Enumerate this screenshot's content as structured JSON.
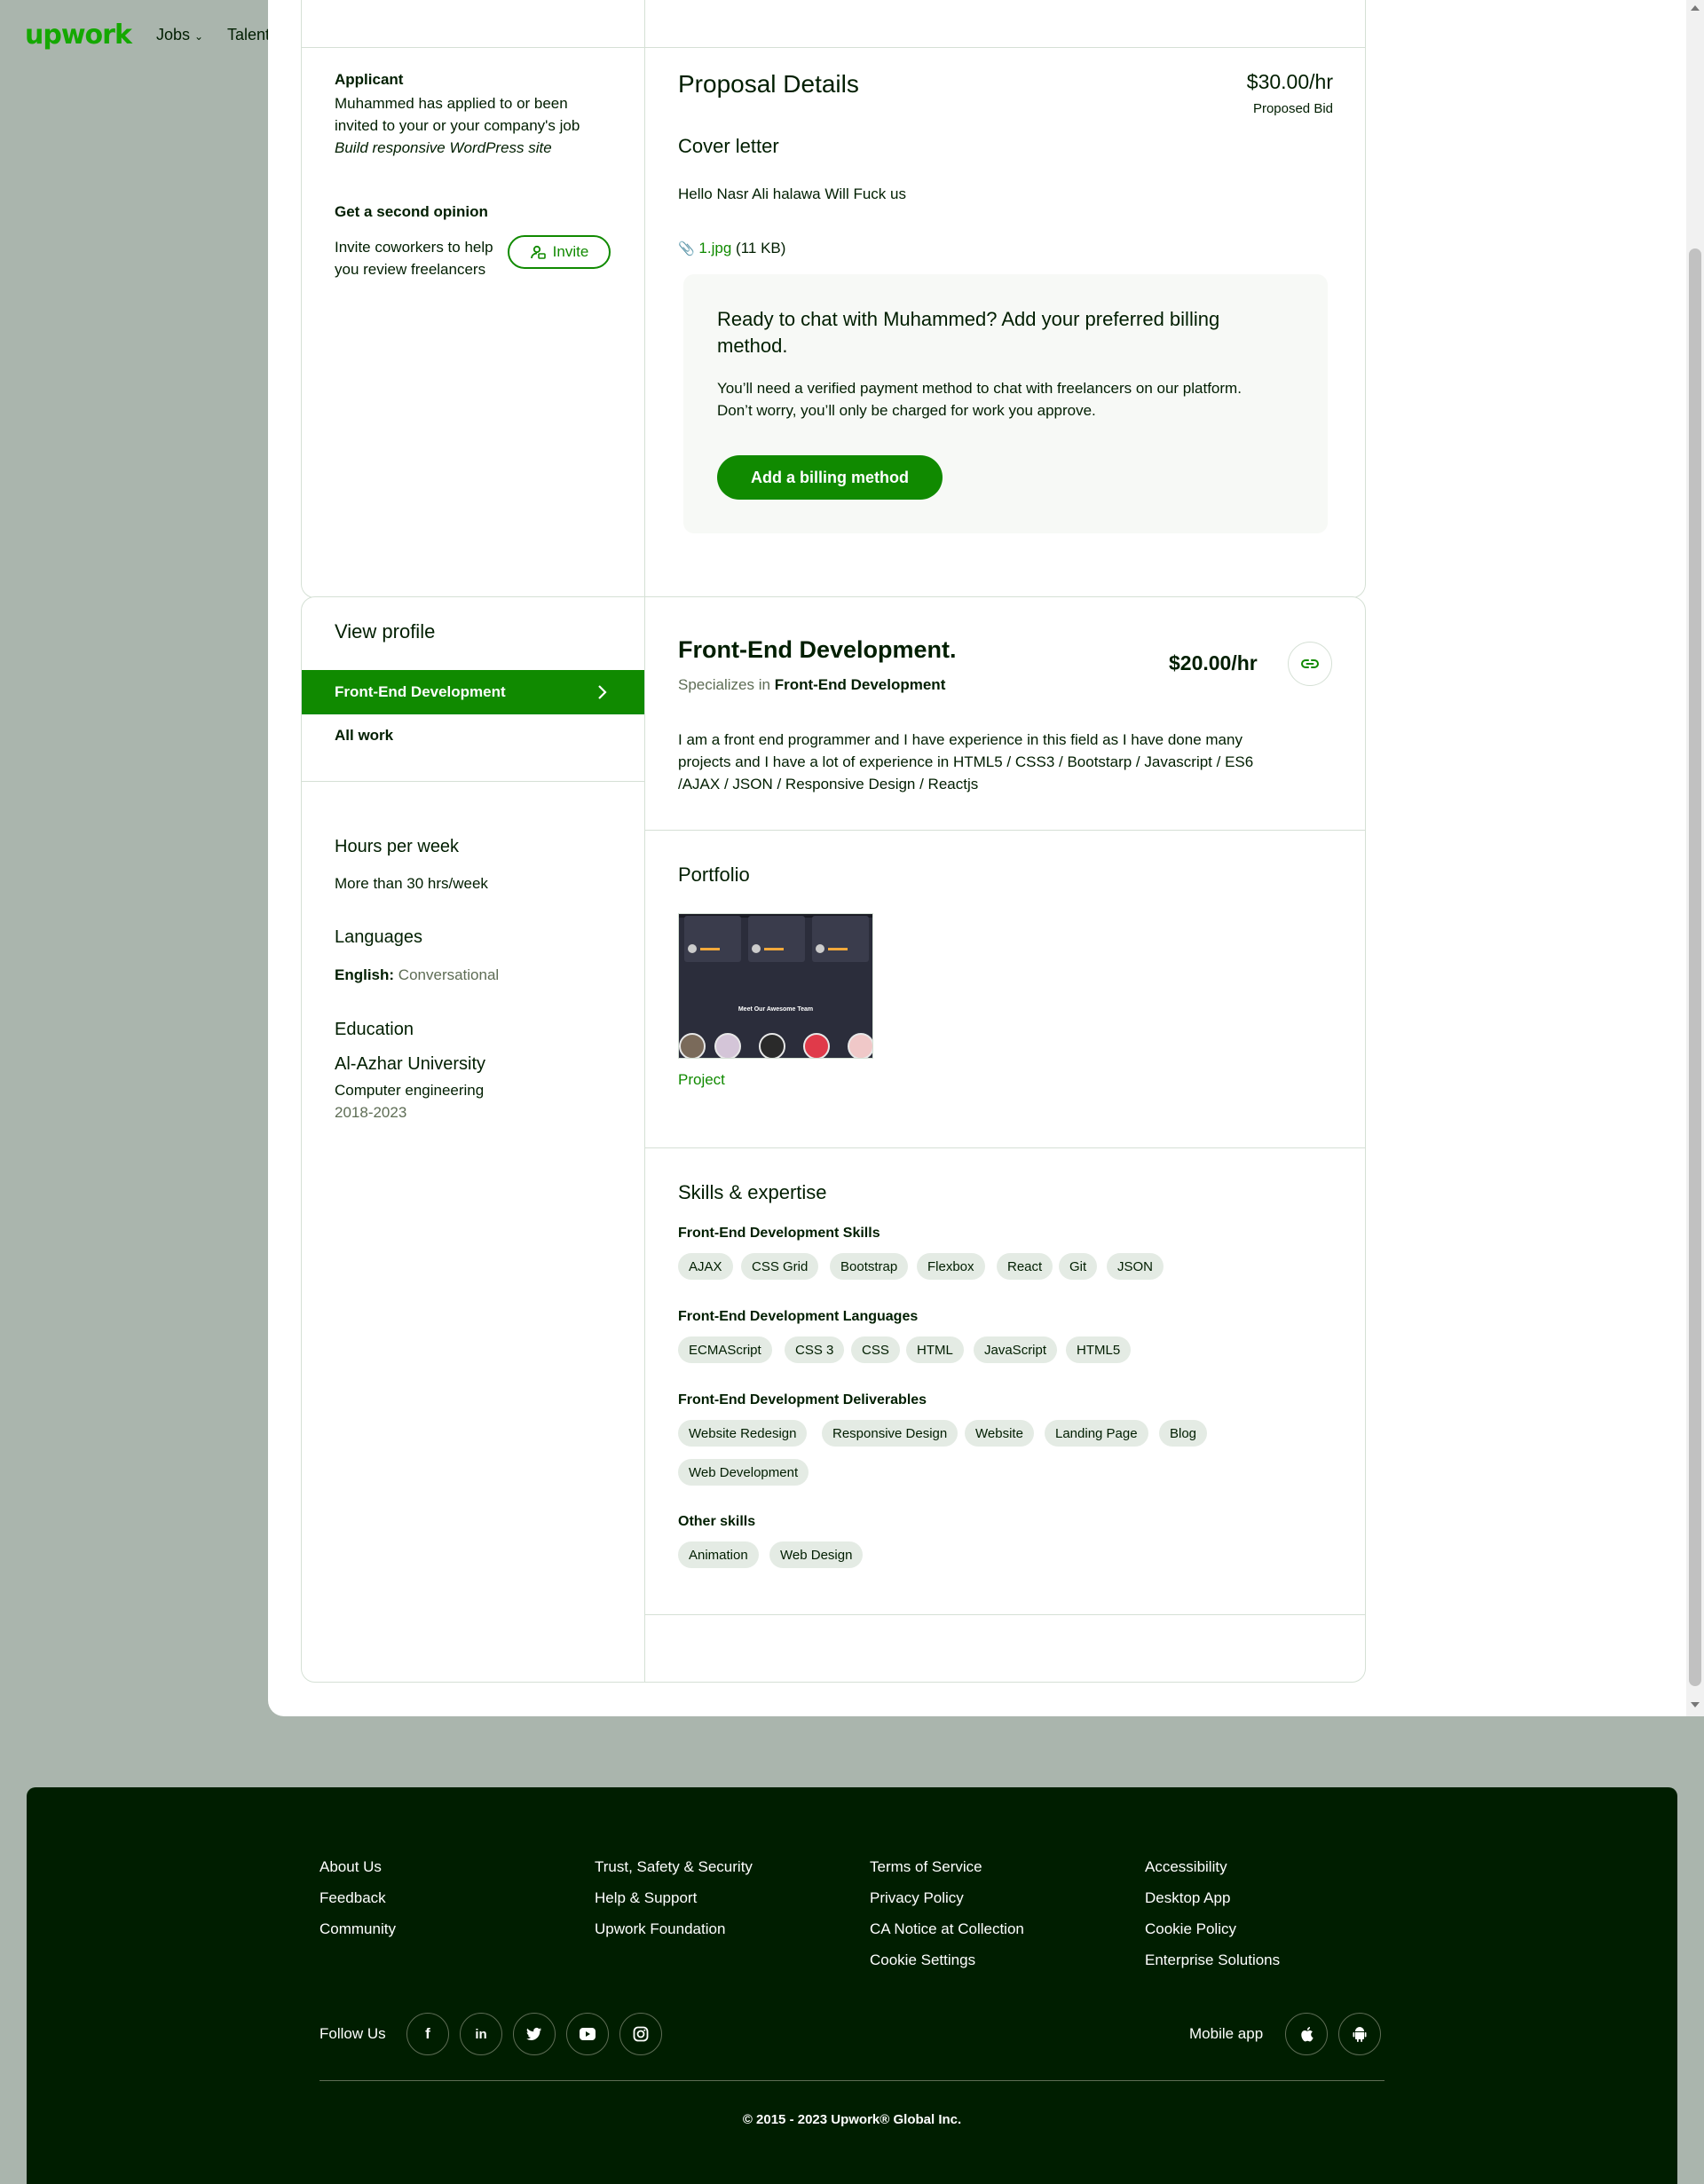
{
  "topbar": {
    "logo": "upwork",
    "nav_jobs": "Jobs",
    "nav_talent": "Talent"
  },
  "applicant": {
    "label": "Applicant",
    "line1": "Muhammed has applied to or been",
    "line2": "invited to your or your company's job",
    "job_title": "Build responsive WordPress site"
  },
  "second_opinion": {
    "label": "Get a second opinion",
    "line1": "Invite coworkers to help",
    "line2": "you review freelancers",
    "invite_label": "Invite"
  },
  "proposal": {
    "title": "Proposal Details",
    "rate": "$30.00/hr",
    "rate_caption": "Proposed Bid",
    "cover_letter_title": "Cover letter",
    "cover_letter_text": "Hello Nasr Ali halawa Will Fuck us",
    "attachment_name": "1.jpg",
    "attachment_size": "(11 KB)"
  },
  "billing": {
    "title_line1": "Ready to chat with Muhammed? Add your preferred billing",
    "title_line2": "method.",
    "text_line1": "You’ll need a verified payment method to chat with freelancers on our platform.",
    "text_line2": "Don’t worry, you’ll only be charged for work you approve.",
    "button_label": "Add a billing method"
  },
  "sidebar": {
    "view_profile": "View profile",
    "items": [
      {
        "label": "Front-End Development",
        "active": true
      },
      {
        "label": "All work",
        "active": false
      }
    ],
    "hours_title": "Hours per week",
    "hours_value": "More than 30 hrs/week",
    "languages_title": "Languages",
    "language_name": "English:",
    "language_level": "Conversational",
    "education_title": "Education",
    "school": "Al-Azhar University",
    "degree": "Computer engineering",
    "years": "2018-2023"
  },
  "profile": {
    "title": "Front-End Development.",
    "rate": "$20.00/hr",
    "specializes_prefix": "Specializes in",
    "specializes_value": "Front-End Development",
    "bio_line1": "I am a front end programmer and I have experience in this field as I have done many",
    "bio_line2": "projects and I have a lot of experience in HTML5 / CSS3 / Bootstarp / Javascript / ES6",
    "bio_line3": "/AJAX / JSON / Responsive Design / Reactjs"
  },
  "portfolio": {
    "title": "Portfolio",
    "thumb_caption": "Meet Our Awesome Team",
    "project_label": "Project"
  },
  "skills": {
    "title": "Skills & expertise",
    "groups": [
      {
        "title": "Front-End Development Skills",
        "items": [
          "AJAX",
          "CSS Grid",
          "Bootstrap",
          "Flexbox",
          "React",
          "Git",
          "JSON"
        ]
      },
      {
        "title": "Front-End Development Languages",
        "items": [
          "ECMAScript",
          "CSS 3",
          "CSS",
          "HTML",
          "JavaScript",
          "HTML5"
        ]
      },
      {
        "title": "Front-End Development Deliverables",
        "items": [
          "Website Redesign",
          "Responsive Design",
          "Website",
          "Landing Page",
          "Blog",
          "Web Development"
        ]
      },
      {
        "title": "Other skills",
        "items": [
          "Animation",
          "Web Design"
        ]
      }
    ]
  },
  "footer": {
    "col1": [
      "About Us",
      "Feedback",
      "Community"
    ],
    "col2": [
      "Trust, Safety & Security",
      "Help & Support",
      "Upwork Foundation"
    ],
    "col3": [
      "Terms of Service",
      "Privacy Policy",
      "CA Notice at Collection",
      "Cookie Settings"
    ],
    "col4": [
      "Accessibility",
      "Desktop App",
      "Cookie Policy",
      "Enterprise Solutions"
    ],
    "follow_us": "Follow Us",
    "social_icons": [
      "facebook-icon",
      "linkedin-icon",
      "twitter-icon",
      "youtube-icon",
      "instagram-icon"
    ],
    "mobile_app": "Mobile app",
    "app_icons": [
      "apple-icon",
      "android-icon"
    ],
    "copyright": "© 2015 - 2023 Upwork® Global Inc."
  },
  "colors": {
    "brand_green": "#108a00",
    "footer_bg": "#001e00",
    "backdrop": "#aab5ad"
  }
}
